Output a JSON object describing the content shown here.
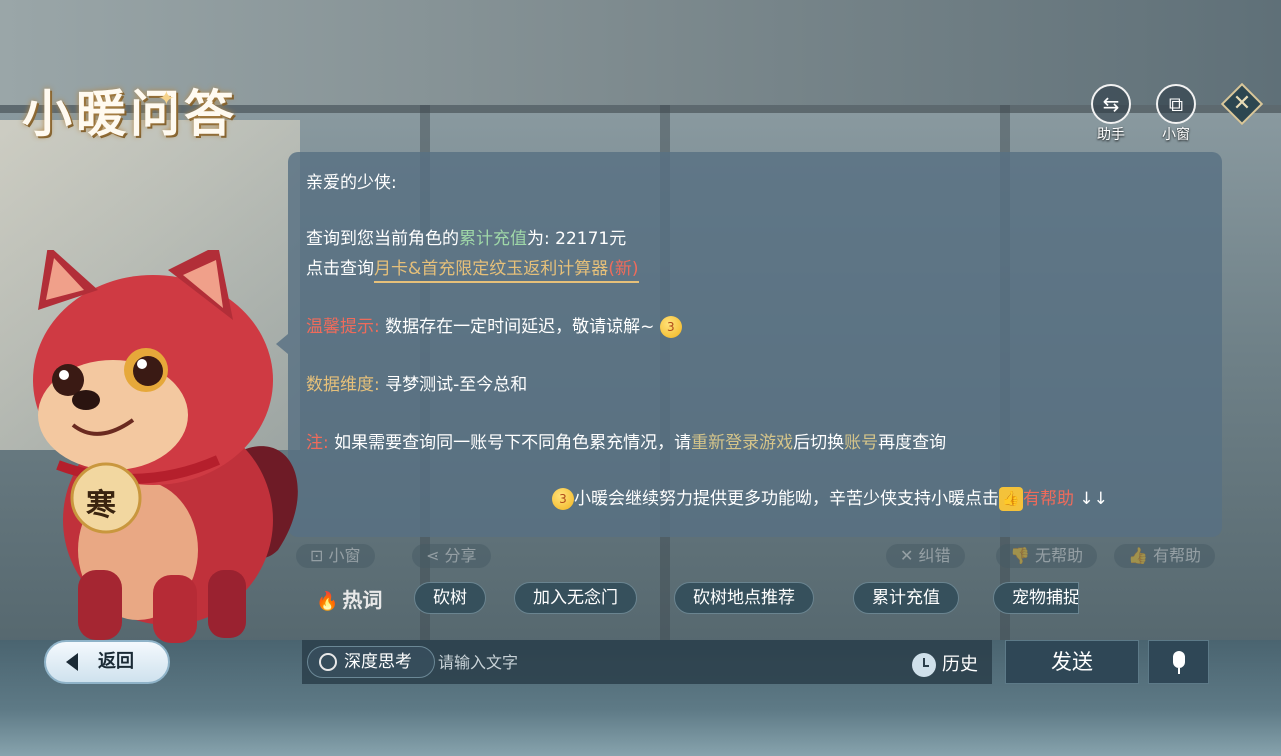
{
  "title": "小暖问答",
  "top_buttons": {
    "assistant_label": "助手",
    "mini_window_label": "小窗"
  },
  "message": {
    "greeting": "亲爱的少侠:",
    "line1_prefix": "查询到您当前角色的",
    "line1_highlight": "累计充值",
    "line1_suffix": "为: 22171元",
    "line2_prefix": "点击查询",
    "line2_link": "月卡&首充限定纹玉返利计算器",
    "line2_new": "(新)",
    "tip_label": "温馨提示:",
    "tip_text": "数据存在一定时间延迟，敬请谅解~",
    "dimension_label": "数据维度:",
    "dimension_text": "寻梦测试-至今总和",
    "note_label": "注:",
    "note_text_1": "如果需要查询同一账号下不同角色累充情况，请",
    "note_highlight_1": "重新登录游戏",
    "note_text_2": "后切换",
    "note_highlight_2": "账号",
    "note_text_3": "再度查询",
    "closing_text": "小暖会继续努力提供更多功能呦，辛苦少侠支持小暖点击",
    "closing_highlight": "有帮助",
    "closing_arrows": "↓↓"
  },
  "actions": {
    "mini_window": "小窗",
    "share": "分享",
    "correct": "纠错",
    "not_helpful": "无帮助",
    "helpful": "有帮助"
  },
  "hot_words": {
    "label": "热词",
    "chips": [
      "砍树",
      "加入无念门",
      "砍树地点推荐",
      "累计充值",
      "宠物捕捉"
    ]
  },
  "mascot": {
    "tag_text": "寒"
  },
  "bottom": {
    "back_label": "返回",
    "deep_think_label": "深度思考",
    "input_placeholder": "请输入文字",
    "history_label": "历史",
    "send_label": "发送"
  },
  "icons": {
    "assistant": "swap-arrows-icon",
    "mini_window": "mini-window-icon",
    "close": "close-diamond-icon",
    "fire": "fire-icon",
    "clock": "clock-icon",
    "mic": "microphone-icon",
    "back": "back-arrow-icon"
  }
}
